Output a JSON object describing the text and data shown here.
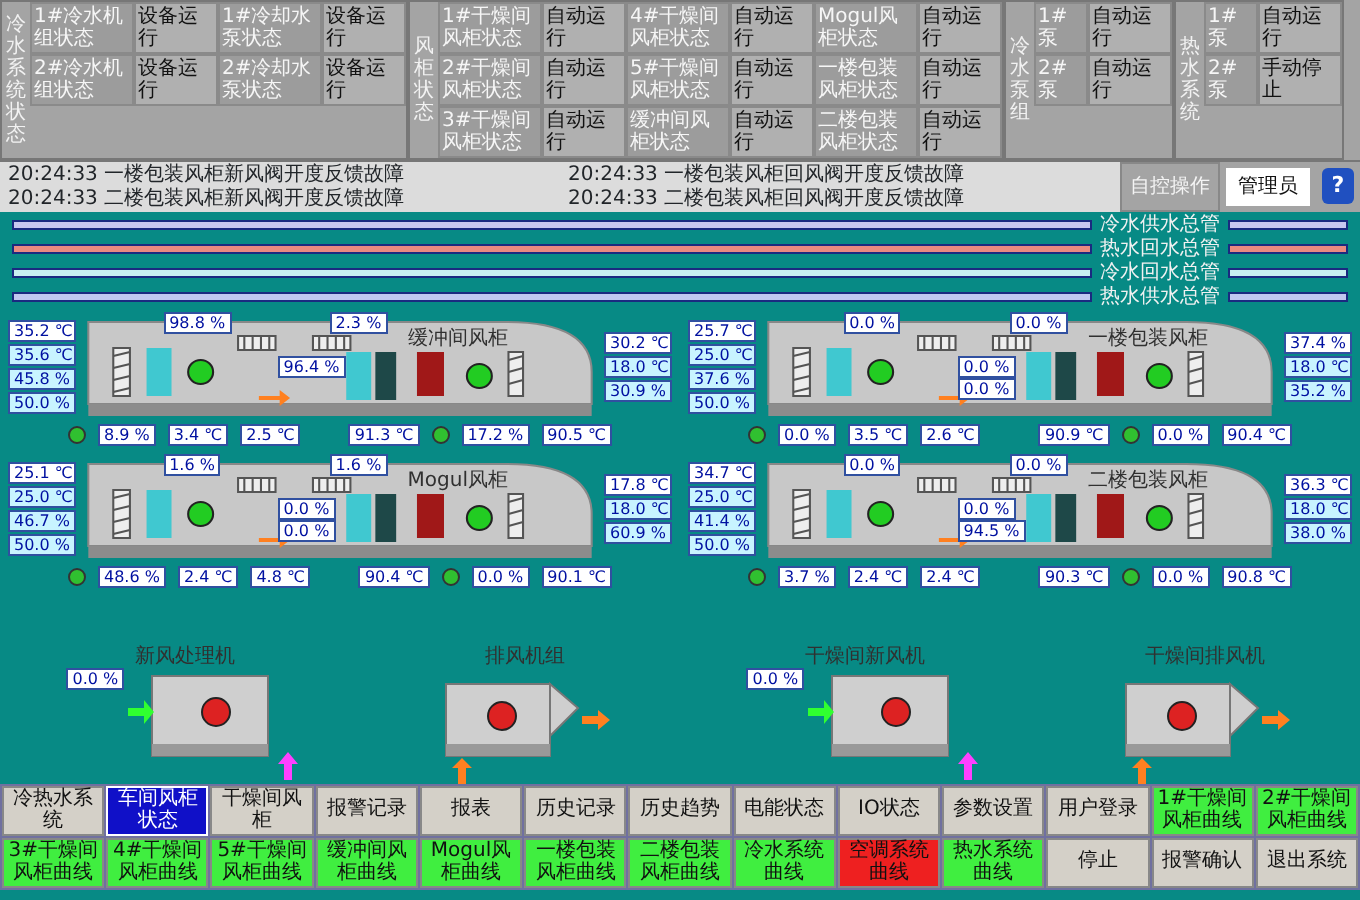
{
  "status_groups": [
    {
      "label": "冷水系统状态",
      "kind": "equipment",
      "rows": [
        [
          {
            "name": "1#冷水机组状态",
            "state": "设备运行"
          },
          {
            "name": "1#冷却水泵状态",
            "state": "设备运行"
          }
        ],
        [
          {
            "name": "2#冷水机组状态",
            "state": "设备运行"
          },
          {
            "name": "2#冷却水泵状态",
            "state": "设备运行"
          }
        ]
      ]
    },
    {
      "label": "风柜状态",
      "kind": "equipment",
      "rows": [
        [
          {
            "name": "1#干燥间风柜状态",
            "state": "自动运行"
          },
          {
            "name": "4#干燥间风柜状态",
            "state": "自动运行"
          },
          {
            "name": "Mogul风柜状态",
            "state": "自动运行"
          }
        ],
        [
          {
            "name": "2#干燥间风柜状态",
            "state": "自动运行"
          },
          {
            "name": "5#干燥间风柜状态",
            "state": "自动运行"
          },
          {
            "name": "一楼包装风柜状态",
            "state": "自动运行"
          }
        ],
        [
          {
            "name": "3#干燥间风柜状态",
            "state": "自动运行"
          },
          {
            "name": "缓冲间风柜状态",
            "state": "自动运行"
          },
          {
            "name": "二楼包装风柜状态",
            "state": "自动运行"
          }
        ]
      ]
    },
    {
      "label": "冷水泵组",
      "kind": "pumps",
      "rows": [
        [
          {
            "name": "1#泵",
            "state": "自动运行"
          }
        ],
        [
          {
            "name": "2#泵",
            "state": "自动运行"
          }
        ]
      ]
    },
    {
      "label": "热水系统",
      "kind": "pumps",
      "rows": [
        [
          {
            "name": "1#泵",
            "state": "自动运行"
          }
        ],
        [
          {
            "name": "2#泵",
            "state": "手动停止"
          }
        ]
      ]
    }
  ],
  "alarms": [
    {
      "time": "20:24:33",
      "message": "一楼包装风柜新风阀开度反馈故障"
    },
    {
      "time": "20:24:33",
      "message": "一楼包装风柜回风阀开度反馈故障"
    },
    {
      "time": "20:24:33",
      "message": "二楼包装风柜新风阀开度反馈故障"
    },
    {
      "time": "20:24:33",
      "message": "二楼包装风柜回风阀开度反馈故障"
    }
  ],
  "control_mode": "自控操作",
  "user": "管理员",
  "help_icon": "?",
  "pipes": [
    {
      "label": "冷水供水总管",
      "color": "#c8c8f0"
    },
    {
      "label": "热水回水总管",
      "color": "#e88a80"
    },
    {
      "label": "冷水回水总管",
      "color": "#c8f0f0"
    },
    {
      "label": "热水供水总管",
      "color": "#c0c8f0"
    }
  ],
  "ahus": [
    {
      "name": "缓冲间风柜",
      "fan_running": true,
      "left_readings": [
        "35.2 ℃",
        "35.6 ℃",
        "45.8 %",
        "50.0 %"
      ],
      "right_readings": [
        "30.2 ℃",
        "18.0 ℃",
        "30.9 %"
      ],
      "damper_readings": [
        "98.8 %",
        "2.3 %"
      ],
      "mid_readings": [
        "96.4 %"
      ],
      "cold_valve": "8.9 %",
      "cold_temps": [
        "3.4 ℃",
        "2.5 ℃"
      ],
      "hot_temps": [
        "91.3 ℃",
        "90.5 ℃"
      ],
      "hot_valve": "17.2 %"
    },
    {
      "name": "一楼包装风柜",
      "fan_running": true,
      "left_readings": [
        "25.7 ℃",
        "25.0 ℃",
        "37.6 %",
        "50.0 %"
      ],
      "right_readings": [
        "37.4 %",
        "18.0 ℃",
        "35.2 %"
      ],
      "damper_readings": [
        "0.0 %",
        "0.0 %"
      ],
      "mid_readings": [
        "0.0 %",
        "0.0 %"
      ],
      "cold_valve": "0.0 %",
      "cold_temps": [
        "3.5 ℃",
        "2.6 ℃"
      ],
      "hot_temps": [
        "90.9 ℃",
        "90.4 ℃"
      ],
      "hot_valve": "0.0 %"
    },
    {
      "name": "Mogul风柜",
      "fan_running": true,
      "left_readings": [
        "25.1 ℃",
        "25.0 ℃",
        "46.7 %",
        "50.0 %"
      ],
      "right_readings": [
        "17.8 ℃",
        "18.0 ℃",
        "60.9 %"
      ],
      "damper_readings": [
        "1.6 %",
        "1.6 %"
      ],
      "mid_readings": [
        "0.0 %",
        "0.0 %"
      ],
      "cold_valve": "48.6 %",
      "cold_temps": [
        "2.4 ℃",
        "4.8 ℃"
      ],
      "hot_temps": [
        "90.4 ℃",
        "90.1 ℃"
      ],
      "hot_valve": "0.0 %"
    },
    {
      "name": "二楼包装风柜",
      "fan_running": true,
      "left_readings": [
        "34.7 ℃",
        "25.0 ℃",
        "41.4 %",
        "50.0 %"
      ],
      "right_readings": [
        "36.3 ℃",
        "18.0 ℃",
        "38.0 %"
      ],
      "damper_readings": [
        "0.0 %",
        "0.0 %"
      ],
      "mid_readings": [
        "0.0 %",
        "94.5 %"
      ],
      "cold_valve": "3.7 %",
      "cold_temps": [
        "2.4 ℃",
        "2.4 ℃"
      ],
      "hot_temps": [
        "90.3 ℃",
        "90.8 ℃"
      ],
      "hot_valve": "0.0 %"
    }
  ],
  "units": [
    {
      "name": "新风处理机",
      "kind": "supply",
      "reading": "0.0 %",
      "fan_running": false
    },
    {
      "name": "排风机组",
      "kind": "exhaust",
      "fan_running": false
    },
    {
      "name": "干燥间新风机",
      "kind": "supply",
      "reading": "0.0 %",
      "fan_running": false
    },
    {
      "name": "干燥间排风机",
      "kind": "exhaust",
      "fan_running": false
    }
  ],
  "nav": [
    {
      "label": "冷热水系统",
      "selected": false,
      "color": "#d4d0c8"
    },
    {
      "label": "车间风柜状态",
      "selected": true,
      "color": "#1010c8"
    },
    {
      "label": "干燥间风柜",
      "selected": false,
      "color": "#d4d0c8"
    },
    {
      "label": "报警记录",
      "selected": false,
      "color": "#d4d0c8"
    },
    {
      "label": "报表",
      "selected": false,
      "color": "#d4d0c8"
    },
    {
      "label": "历史记录",
      "selected": false,
      "color": "#d4d0c8"
    },
    {
      "label": "历史趋势",
      "selected": false,
      "color": "#d4d0c8"
    },
    {
      "label": "电能状态",
      "selected": false,
      "color": "#d4d0c8"
    },
    {
      "label": "IO状态",
      "selected": false,
      "color": "#d4d0c8"
    },
    {
      "label": "参数设置",
      "selected": false,
      "color": "#d4d0c8"
    },
    {
      "label": "用户登录",
      "selected": false,
      "color": "#d4d0c8"
    },
    {
      "label": "1#干燥间风柜曲线",
      "selected": false,
      "color": "#40ee40"
    },
    {
      "label": "2#干燥间风柜曲线",
      "selected": false,
      "color": "#40ee40"
    },
    {
      "label": "3#干燥间风柜曲线",
      "selected": false,
      "color": "#40ee40"
    },
    {
      "label": "4#干燥间风柜曲线",
      "selected": false,
      "color": "#40ee40"
    },
    {
      "label": "5#干燥间风柜曲线",
      "selected": false,
      "color": "#40ee40"
    },
    {
      "label": "缓冲间风柜曲线",
      "selected": false,
      "color": "#40ee40"
    },
    {
      "label": "Mogul风柜曲线",
      "selected": false,
      "color": "#40ee40"
    },
    {
      "label": "一楼包装风柜曲线",
      "selected": false,
      "color": "#40ee40"
    },
    {
      "label": "二楼包装风柜曲线",
      "selected": false,
      "color": "#40ee40"
    },
    {
      "label": "冷水系统曲线",
      "selected": false,
      "color": "#40ee40"
    },
    {
      "label": "空调系统曲线",
      "selected": false,
      "color": "#ee2020"
    },
    {
      "label": "热水系统曲线",
      "selected": false,
      "color": "#40ee40"
    },
    {
      "label": "停止",
      "selected": false,
      "color": "#d4d0c8"
    },
    {
      "label": "报警确认",
      "selected": false,
      "color": "#d4d0c8"
    },
    {
      "label": "退出系统",
      "selected": false,
      "color": "#d4d0c8"
    }
  ]
}
